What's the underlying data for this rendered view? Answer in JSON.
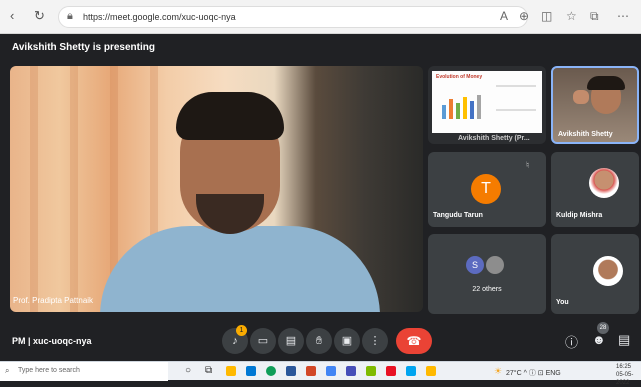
{
  "browser": {
    "url": "https://meet.google.com/xuc-uoqc-nya",
    "icons": [
      "back-icon",
      "refresh-icon",
      "lock-icon",
      "read-aloud-icon",
      "zoom-icon",
      "tab-icon",
      "favorites-icon",
      "collections-icon",
      "extensions-icon"
    ]
  },
  "meet": {
    "presenting_banner": "Avikshith Shetty is presenting",
    "main_speaker": "Prof. Pradipta Pattnaik",
    "tiles": {
      "presentation": {
        "label": "Avikshith Shetty (Pr...",
        "slide_title": "Evolution of Money"
      },
      "avikshith": {
        "name": "Avikshith Shetty"
      },
      "tangudu": {
        "name": "Tangudu Tarun",
        "avatar_letter": "T",
        "avatar_color": "#f57c00"
      },
      "kuldip": {
        "name": "Kuldip Mishra"
      },
      "others": {
        "label": "22 others",
        "avatar_letter": "S"
      },
      "you": {
        "name": "You"
      }
    },
    "meeting_code": "PM  |  xuc-uoqc-nya",
    "controls": {
      "hand_badge": "1",
      "people_count": "28"
    },
    "accent_end_call": "#ea4335"
  },
  "taskbar": {
    "search_placeholder": "Type here to search",
    "weather": "27°C  ^ ⓘ ⊡ ENG",
    "time": "16:25",
    "date": "05-05-2022"
  }
}
